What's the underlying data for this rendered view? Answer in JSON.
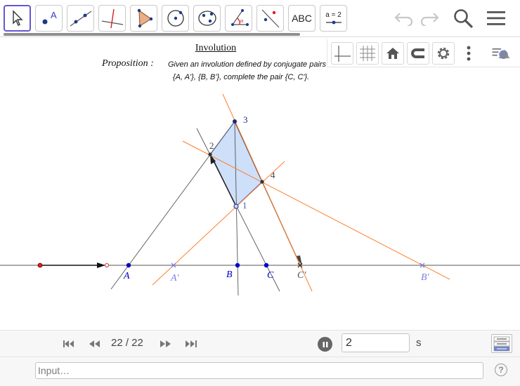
{
  "toolbar": {
    "tools": [
      {
        "id": "move",
        "name": "Move"
      },
      {
        "id": "point",
        "name": "Point",
        "glyph_label": "A"
      },
      {
        "id": "line",
        "name": "Line"
      },
      {
        "id": "perpendicular",
        "name": "Perpendicular Line"
      },
      {
        "id": "polygon",
        "name": "Polygon"
      },
      {
        "id": "circle",
        "name": "Circle with Center through Point"
      },
      {
        "id": "ellipse",
        "name": "Ellipse"
      },
      {
        "id": "angle",
        "name": "Angle"
      },
      {
        "id": "reflect",
        "name": "Reflect about Line"
      },
      {
        "id": "text",
        "name": "Text",
        "label": "ABC"
      },
      {
        "id": "slider",
        "name": "Slider",
        "label": "a = 2"
      }
    ],
    "selected_tool": "move"
  },
  "construction": {
    "title": "Involution",
    "proposition_label": "Proposition :",
    "proposition_line1": "Given an involution defined by conjugate pairs",
    "proposition_line2": "{A, A'}, {B, B'},  complete the pair {C, C'}.",
    "point_labels": {
      "A": "A",
      "A_prime": "A′",
      "B": "B",
      "B_prime": "B′",
      "C": "C",
      "C_prime": "C′",
      "p1": "1",
      "p2": "2",
      "p3": "3",
      "p4": "4"
    }
  },
  "colors": {
    "accent": "#6557d2",
    "orange_line": "#ff7f2a",
    "point_blue": "#0000cc",
    "prime_label": "#8080e0",
    "quad_fill": "#c8dcf8",
    "red_point": "#d42020"
  },
  "animation": {
    "frame_counter": "22 / 22",
    "speed_value": "2",
    "speed_unit": "s"
  },
  "input_bar": {
    "placeholder": "Input…"
  },
  "icons": [
    "undo-icon",
    "redo-icon",
    "search-icon",
    "menu-icon",
    "axes-icon",
    "grid-icon",
    "home-icon",
    "magnet-icon",
    "gear-icon",
    "more-vert-icon",
    "style-bar-toggle-icon",
    "pause-icon",
    "algebra-table-icon",
    "help-icon"
  ]
}
